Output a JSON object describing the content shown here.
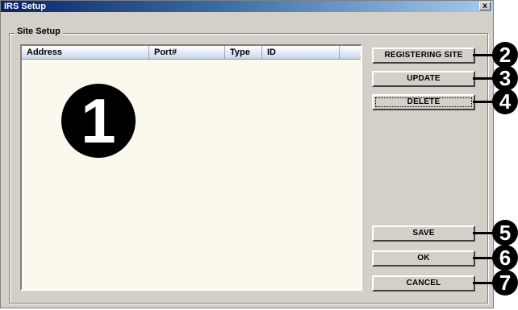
{
  "window": {
    "title": "IRS Setup",
    "close_label": "x"
  },
  "group": {
    "legend": "Site Setup"
  },
  "list": {
    "columns": [
      "Address",
      "Port#",
      "Type",
      "ID"
    ],
    "rows": []
  },
  "buttons": {
    "registering_site": "REGISTERING SITE",
    "update": "UPDATE",
    "delete": "DELETE",
    "save": "SAVE",
    "ok": "OK",
    "cancel": "CANCEL"
  },
  "callouts": [
    "1",
    "2",
    "3",
    "4",
    "5",
    "6",
    "7"
  ]
}
